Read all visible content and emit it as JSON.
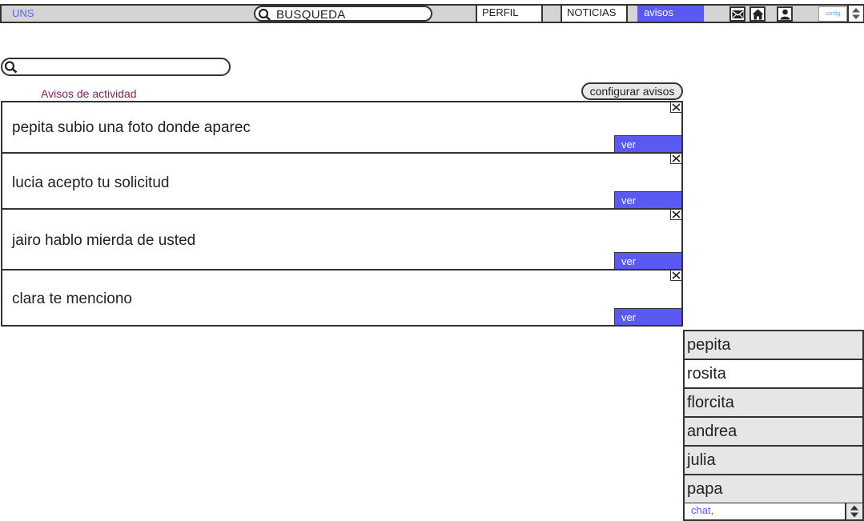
{
  "topbar": {
    "brand": "UNS",
    "search_label": "BUSQUEDA",
    "nav": {
      "perfil": "PERFIL",
      "noticias": "NOTICIAS",
      "avisos": "avisos"
    },
    "config_label": "config",
    "icons": [
      "mail-icon",
      "home-icon",
      "user-icon"
    ]
  },
  "avisos": {
    "title": "Avisos de actividad",
    "configure_label": "configurar avisos",
    "items": [
      {
        "text": "pepita subio una  foto donde aparec",
        "action": "ver"
      },
      {
        "text": "lucia acepto tu  solicitud",
        "action": "ver"
      },
      {
        "text": "jairo hablo mierda de usted",
        "action": "ver"
      },
      {
        "text": "clara te menciono",
        "action": "ver"
      }
    ]
  },
  "chat": {
    "contacts": [
      "pepita",
      "rosita",
      "florcita",
      "andrea",
      "julia",
      "papa"
    ],
    "input_label": "chat,"
  },
  "colors": {
    "accent": "#5a5af2",
    "title": "#8a1f5a",
    "bar": "#d4d4d4"
  }
}
